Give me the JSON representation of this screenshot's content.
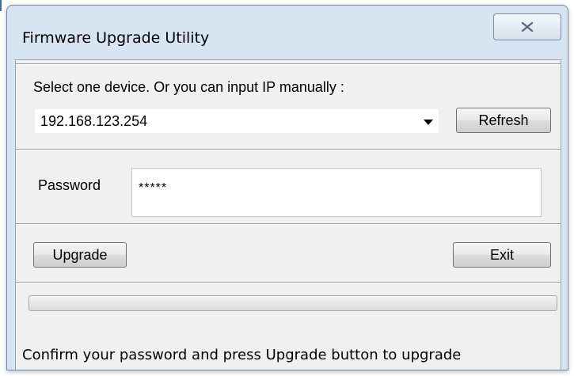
{
  "window": {
    "title": "Firmware Upgrade Utility"
  },
  "device": {
    "prompt": "Select one device. Or you can input IP manually :",
    "selected_ip": "192.168.123.254",
    "refresh_label": "Refresh"
  },
  "password": {
    "label": "Password",
    "value": "*****"
  },
  "actions": {
    "upgrade_label": "Upgrade",
    "exit_label": "Exit"
  },
  "progress": {
    "fraction": 0.0
  },
  "status": {
    "message": "Confirm your password and press Upgrade button to upgrade"
  },
  "icons": {
    "close": "close-icon",
    "dropdown": "chevron-down-icon"
  },
  "colors": {
    "frame": "#d7e4f2",
    "client": "#f0f0f0"
  }
}
